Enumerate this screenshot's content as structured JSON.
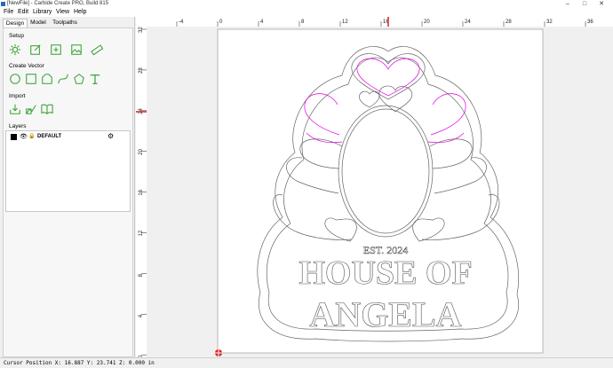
{
  "window": {
    "title": "[NewFile] - Carbide Create PRO, Build 815",
    "min": "–",
    "max": "□",
    "close": "✕"
  },
  "menu": [
    "File",
    "Edit",
    "Library",
    "View",
    "Help"
  ],
  "tabs": [
    "Design",
    "Model",
    "Toolpaths"
  ],
  "sections": {
    "setup": "Setup",
    "create_vector": "Create Vector",
    "import": "Import",
    "layers": "Layers"
  },
  "layer": {
    "name": "DEFAULT"
  },
  "ruler": {
    "x_ticks": [
      "-4",
      "0",
      "4",
      "8",
      "12",
      "16",
      "20",
      "24",
      "28",
      "32",
      "36"
    ],
    "y_ticks": [
      "32",
      "28",
      "24",
      "20",
      "16",
      "12",
      "8",
      "4",
      "0"
    ]
  },
  "design": {
    "line1": "EST. 2024",
    "line2": "HOUSE OF",
    "line3": "ANGELA"
  },
  "status": {
    "text": "Cursor Position X: 16.887 Y: 23.741 Z: 0.000 in"
  },
  "colors": {
    "accent": "#3aa335",
    "cursor_marker": "#e02020",
    "path_selected": "#e000e0"
  },
  "icons": {
    "setup": [
      "settings-gear-icon",
      "edit-job-icon",
      "import-image-icon",
      "image-icon",
      "ruler-icon"
    ],
    "vector": [
      "circle-icon",
      "rectangle-icon",
      "polygon-icon",
      "curve-icon",
      "pentagon-icon",
      "text-icon"
    ],
    "import": [
      "import-download-icon",
      "import-svg-icon",
      "library-book-icon"
    ]
  }
}
